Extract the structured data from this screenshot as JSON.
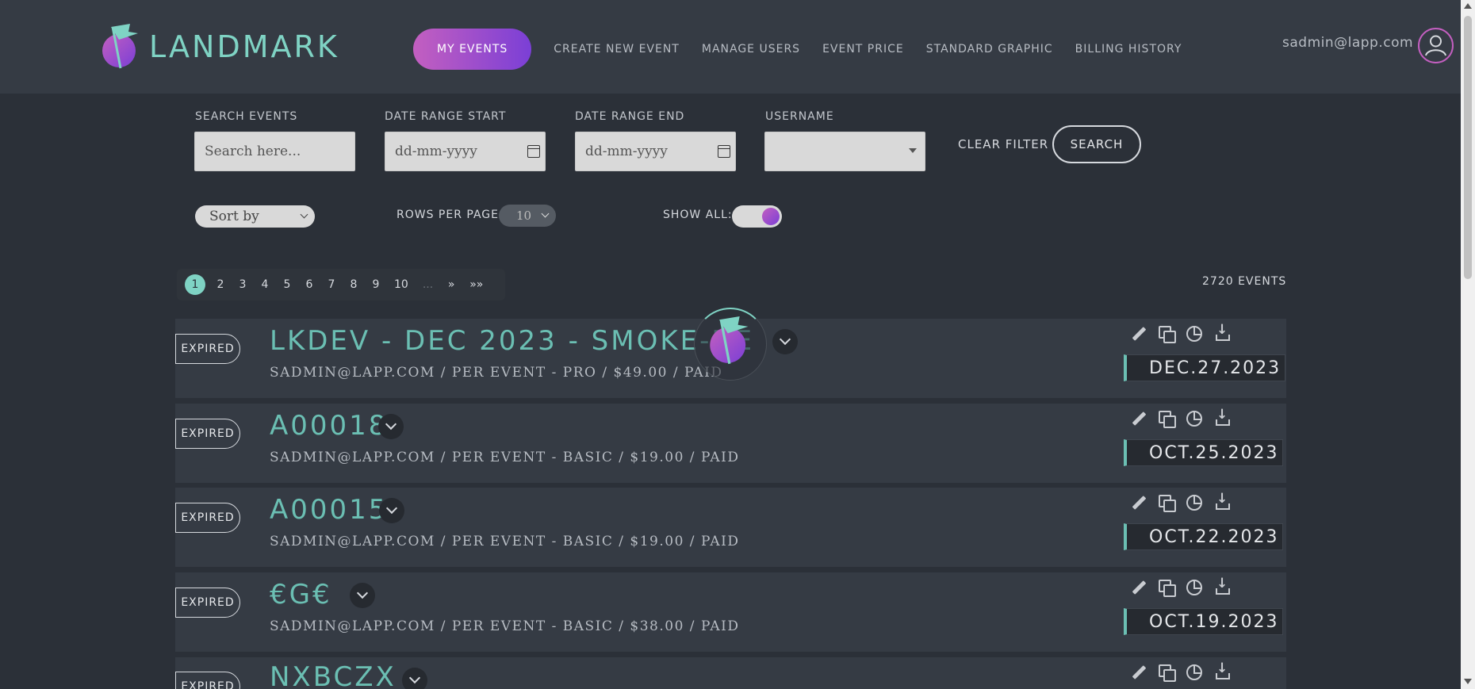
{
  "brand": {
    "name": "LANDMARK"
  },
  "nav": {
    "active": "MY EVENTS",
    "items": [
      "CREATE NEW EVENT",
      "MANAGE USERS",
      "EVENT PRICE",
      "STANDARD GRAPHIC",
      "BILLING HISTORY"
    ]
  },
  "user": {
    "email": "sadmin@lapp.com"
  },
  "filters": {
    "search_label": "SEARCH EVENTS",
    "search_placeholder": "Search here...",
    "date_start_label": "DATE RANGE START",
    "date_start_placeholder": "dd-mm-yyyy",
    "date_end_label": "DATE RANGE END",
    "date_end_placeholder": "dd-mm-yyyy",
    "username_label": "USERNAME",
    "username_value": "",
    "clear_label": "CLEAR FILTER",
    "search_button": "SEARCH",
    "sort_by": "Sort by",
    "rows_label": "ROWS PER PAGE:",
    "rows_value": "10",
    "show_all_label": "SHOW ALL:",
    "show_all_on": true
  },
  "pagination": {
    "pages": [
      "1",
      "2",
      "3",
      "4",
      "5",
      "6",
      "7",
      "8",
      "9",
      "10"
    ],
    "active": "1",
    "ellipsis": "...",
    "next": "»",
    "last": "»»"
  },
  "events_count": "2720 EVENTS",
  "events": [
    {
      "status": "EXPIRED",
      "title": "LKDEV - DEC 2023 - SMOKE-DE",
      "subtitle": "SADMIN@LAPP.COM /  PER EVENT - PRO  /  $49.00  /  PAID",
      "date": "DEC.27.2023"
    },
    {
      "status": "EXPIRED",
      "title": "A00018",
      "subtitle": "SADMIN@LAPP.COM /  PER EVENT - BASIC  /  $19.00  /  PAID",
      "date": "OCT.25.2023"
    },
    {
      "status": "EXPIRED",
      "title": "A00015",
      "subtitle": "SADMIN@LAPP.COM /  PER EVENT - BASIC  /  $19.00  /  PAID",
      "date": "OCT.22.2023"
    },
    {
      "status": "EXPIRED",
      "title": "€G€",
      "subtitle": "SADMIN@LAPP.COM /  PER EVENT - BASIC  /  $38.00  /  PAID",
      "date": "OCT.19.2023"
    },
    {
      "status": "EXPIRED",
      "title": "NXBCZX",
      "subtitle": "",
      "date": ""
    }
  ],
  "colors": {
    "accent": "#7fd3c4",
    "gradient_start": "#c35fc0",
    "gradient_end": "#7b3fd6",
    "background": "#2b3038"
  }
}
